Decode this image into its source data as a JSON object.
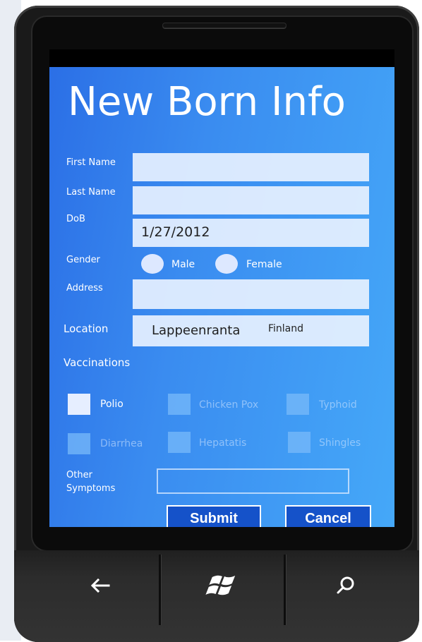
{
  "app": {
    "title": "New Born Info"
  },
  "colors": {
    "screen_start": "#2b6fe6",
    "screen_end": "#45a8f8",
    "button_bg": "#1552c9"
  },
  "form": {
    "first_name": {
      "label": "First Name",
      "value": ""
    },
    "last_name": {
      "label": "Last Name",
      "value": ""
    },
    "dob": {
      "label": "DoB",
      "value": "1/27/2012"
    },
    "gender": {
      "label": "Gender",
      "options": [
        {
          "label": "Male",
          "selected": false
        },
        {
          "label": "Female",
          "selected": false
        }
      ]
    },
    "address": {
      "label": "Address",
      "value": ""
    },
    "location": {
      "label": "Location",
      "city": "Lappeenranta",
      "country": "Finland"
    },
    "vaccinations": {
      "label": "Vaccinations",
      "items": [
        {
          "label": "Polio",
          "checked": true
        },
        {
          "label": "Chicken Pox",
          "checked": false
        },
        {
          "label": "Typhoid",
          "checked": false
        },
        {
          "label": "Diarrhea",
          "checked": false
        },
        {
          "label": "Hepatatis",
          "checked": false
        },
        {
          "label": "Shingles",
          "checked": false
        }
      ]
    },
    "other_symptoms": {
      "label_line1": "Other",
      "label_line2": "Symptoms",
      "value": ""
    },
    "submit_label": "Submit",
    "cancel_label": "Cancel"
  },
  "hardware": {
    "back_icon": "back-arrow-icon",
    "start_icon": "windows-logo-icon",
    "search_icon": "search-icon"
  }
}
